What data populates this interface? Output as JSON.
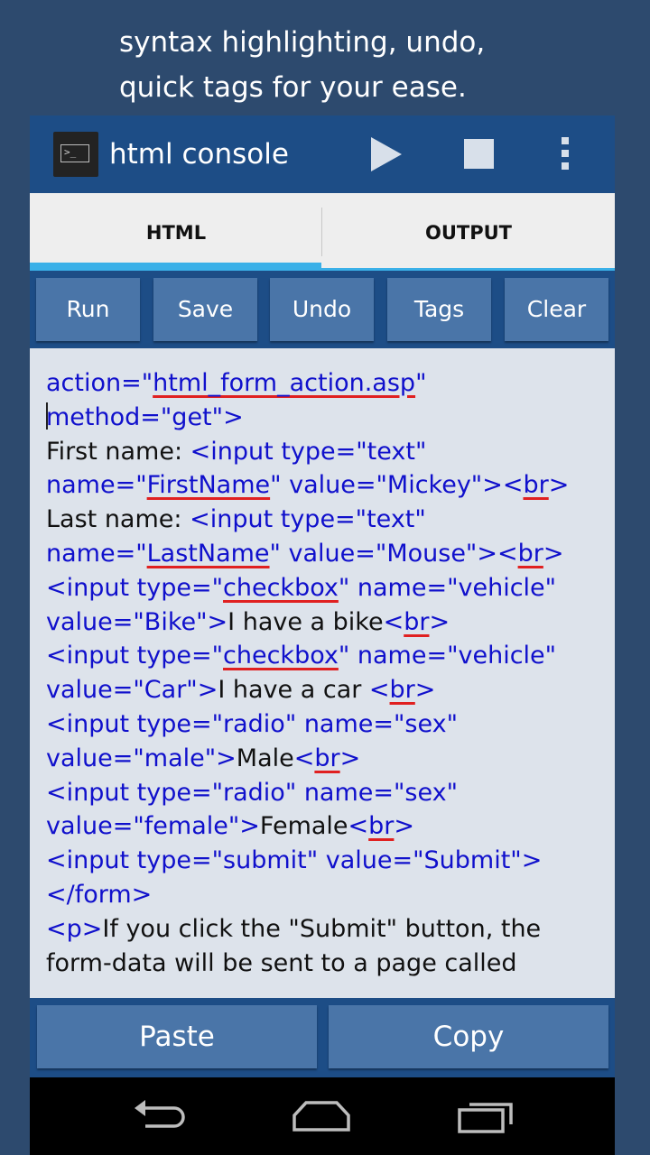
{
  "caption": {
    "line1": "syntax highlighting, undo,",
    "line2": "quick tags for your ease."
  },
  "appbar": {
    "title": "html console"
  },
  "tabs": [
    {
      "label": "HTML",
      "selected": true
    },
    {
      "label": "OUTPUT",
      "selected": false
    }
  ],
  "toolbar": {
    "buttons": [
      "Run",
      "Save",
      "Undo",
      "Tags",
      "Clear"
    ]
  },
  "editor": {
    "lines": [
      [
        {
          "t": "action=\"",
          "c": "tag"
        },
        {
          "t": "html_form_action.asp",
          "c": "tag",
          "err": true
        },
        {
          "t": "\"",
          "c": "tag"
        }
      ],
      [
        {
          "t": "method=\"get\">",
          "c": "tag",
          "cursor": true
        }
      ],
      [
        {
          "t": "First name: ",
          "c": "txt"
        },
        {
          "t": "<input type=\"text\"",
          "c": "tag"
        }
      ],
      [
        {
          "t": "name=\"",
          "c": "tag"
        },
        {
          "t": "FirstName",
          "c": "tag",
          "err": true
        },
        {
          "t": "\" value=\"Mickey\"><",
          "c": "tag"
        },
        {
          "t": "br",
          "c": "tag",
          "err": true
        },
        {
          "t": ">",
          "c": "tag"
        }
      ],
      [
        {
          "t": "Last name: ",
          "c": "txt"
        },
        {
          "t": "<input type=\"text\"",
          "c": "tag"
        }
      ],
      [
        {
          "t": "name=\"",
          "c": "tag"
        },
        {
          "t": "LastName",
          "c": "tag",
          "err": true
        },
        {
          "t": "\" value=\"Mouse\"><",
          "c": "tag"
        },
        {
          "t": "br",
          "c": "tag",
          "err": true
        },
        {
          "t": ">",
          "c": "tag"
        }
      ],
      [
        {
          "t": "<input type=\"",
          "c": "tag"
        },
        {
          "t": "checkbox",
          "c": "tag",
          "err": true
        },
        {
          "t": "\" name=\"vehicle\"",
          "c": "tag"
        }
      ],
      [
        {
          "t": "value=\"Bike\">",
          "c": "tag"
        },
        {
          "t": "I have a bike",
          "c": "txt"
        },
        {
          "t": "<",
          "c": "tag"
        },
        {
          "t": "br",
          "c": "tag",
          "err": true
        },
        {
          "t": ">",
          "c": "tag"
        }
      ],
      [
        {
          "t": "<input type=\"",
          "c": "tag"
        },
        {
          "t": "checkbox",
          "c": "tag",
          "err": true
        },
        {
          "t": "\" name=\"vehicle\"",
          "c": "tag"
        }
      ],
      [
        {
          "t": "value=\"Car\">",
          "c": "tag"
        },
        {
          "t": "I have a car ",
          "c": "txt"
        },
        {
          "t": "<",
          "c": "tag"
        },
        {
          "t": "br",
          "c": "tag",
          "err": true
        },
        {
          "t": ">",
          "c": "tag"
        }
      ],
      [
        {
          "t": "<input type=\"radio\" name=\"sex\"",
          "c": "tag"
        }
      ],
      [
        {
          "t": "value=\"male\">",
          "c": "tag"
        },
        {
          "t": "Male",
          "c": "txt"
        },
        {
          "t": "<",
          "c": "tag"
        },
        {
          "t": "br",
          "c": "tag",
          "err": true
        },
        {
          "t": ">",
          "c": "tag"
        }
      ],
      [
        {
          "t": "<input type=\"radio\" name=\"sex\"",
          "c": "tag"
        }
      ],
      [
        {
          "t": "value=\"female\">",
          "c": "tag"
        },
        {
          "t": "Female",
          "c": "txt"
        },
        {
          "t": "<",
          "c": "tag"
        },
        {
          "t": "br",
          "c": "tag",
          "err": true
        },
        {
          "t": ">",
          "c": "tag"
        }
      ],
      [
        {
          "t": "<input type=\"submit\" value=\"Submit\">",
          "c": "tag"
        }
      ],
      [
        {
          "t": "</form>",
          "c": "tag"
        }
      ],
      [
        {
          "t": "<p>",
          "c": "tag"
        },
        {
          "t": "If you click the \"Submit\" button, the",
          "c": "txt"
        }
      ],
      [
        {
          "t": "form-data will be sent to a page called",
          "c": "txt"
        }
      ]
    ]
  },
  "bottom": {
    "paste_label": "Paste",
    "copy_label": "Copy"
  },
  "colors": {
    "background": "#2d4a6e",
    "appbar": "#1d4d86",
    "button": "#4a75a8",
    "tab_indicator": "#3ab0e8",
    "code_tag": "#1010cc",
    "error_underline": "#e02020"
  },
  "icons": {
    "app": "terminal-icon",
    "run": "play-icon",
    "stop": "stop-icon",
    "overflow": "more-vert-icon",
    "nav_back": "back-icon",
    "nav_home": "home-icon",
    "nav_recent": "recent-apps-icon"
  }
}
